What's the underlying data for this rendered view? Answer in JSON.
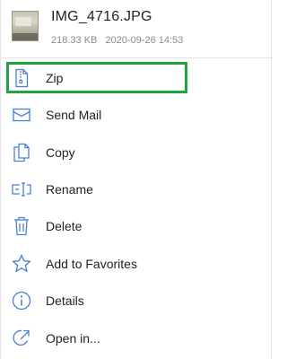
{
  "file": {
    "name": "IMG_4716.JPG",
    "size": "218.33 KB",
    "date": "2020-09-26 14:53"
  },
  "colors": {
    "icon": "#4a7fd0",
    "highlight": "#20a440"
  },
  "menu": [
    {
      "label": "Zip",
      "icon": "zip-file-icon"
    },
    {
      "label": "Send Mail",
      "icon": "mail-icon"
    },
    {
      "label": "Copy",
      "icon": "copy-icon"
    },
    {
      "label": "Rename",
      "icon": "rename-icon"
    },
    {
      "label": "Delete",
      "icon": "trash-icon"
    },
    {
      "label": "Add to Favorites",
      "icon": "star-icon"
    },
    {
      "label": "Details",
      "icon": "info-icon"
    },
    {
      "label": "Open in...",
      "icon": "open-in-icon"
    }
  ]
}
